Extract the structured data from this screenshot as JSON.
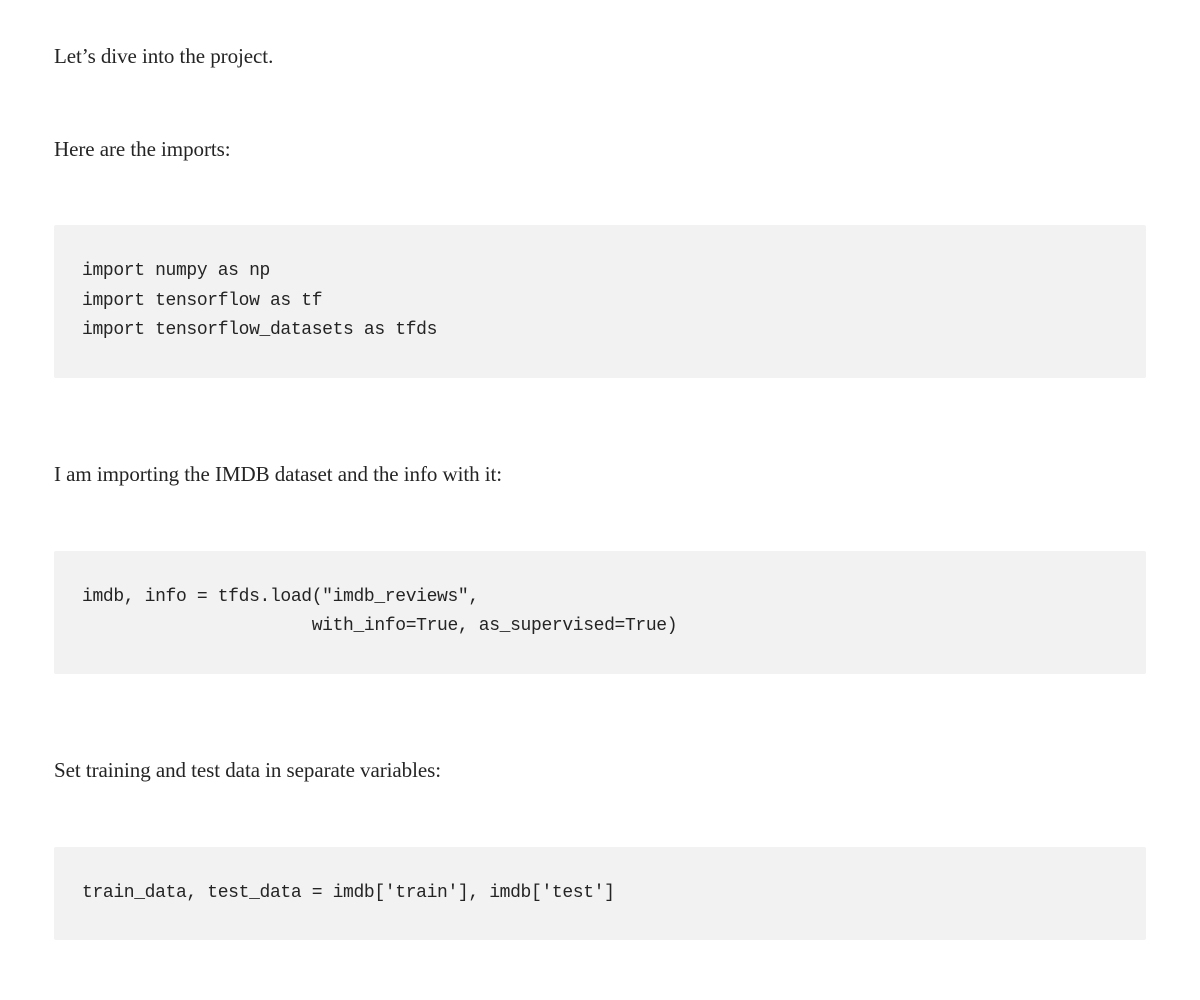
{
  "paragraphs": {
    "p1": "Let’s dive into the project.",
    "p2": "Here are the imports:",
    "p3": "I am importing the IMDB dataset and the info with it:",
    "p4": "Set training and test data in separate variables:"
  },
  "code": {
    "block1": "import numpy as np\nimport tensorflow as tf\nimport tensorflow_datasets as tfds",
    "block2": "imdb, info = tfds.load(\"imdb_reviews\",\n                      with_info=True, as_supervised=True)",
    "block3": "train_data, test_data = imdb['train'], imdb['test']"
  }
}
